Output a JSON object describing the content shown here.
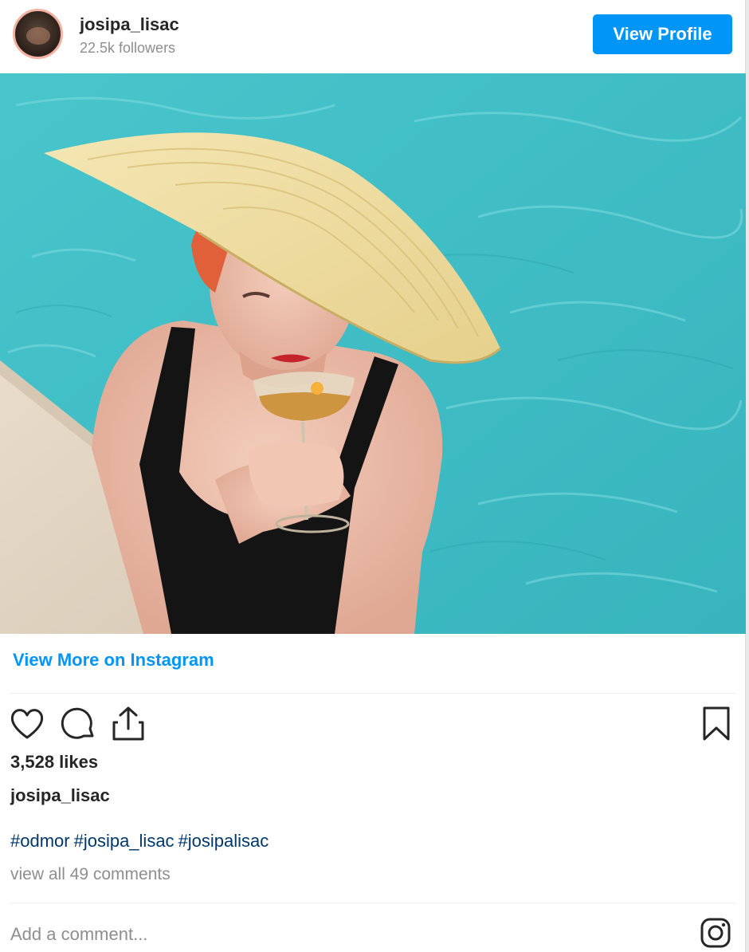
{
  "header": {
    "username": "josipa_lisac",
    "followers": "22.5k followers",
    "view_profile_label": "View Profile"
  },
  "post": {
    "view_more_label": "View More on Instagram",
    "likes": "3,528 likes",
    "caption_user": "josipa_lisac",
    "hashtags": [
      "#odmor",
      "#josipa_lisac",
      "#josipalisac"
    ],
    "view_comments": "view all 49 comments"
  },
  "comment": {
    "placeholder": "Add a comment..."
  },
  "icons": {
    "like": "heart-icon",
    "comment": "comment-icon",
    "share": "share-icon",
    "save": "bookmark-icon",
    "brand": "instagram-icon"
  },
  "colors": {
    "accent": "#0095f6",
    "hashtag": "#00376b",
    "muted": "#8e8e8e",
    "text": "#262626",
    "water": "#3ec1c9"
  }
}
